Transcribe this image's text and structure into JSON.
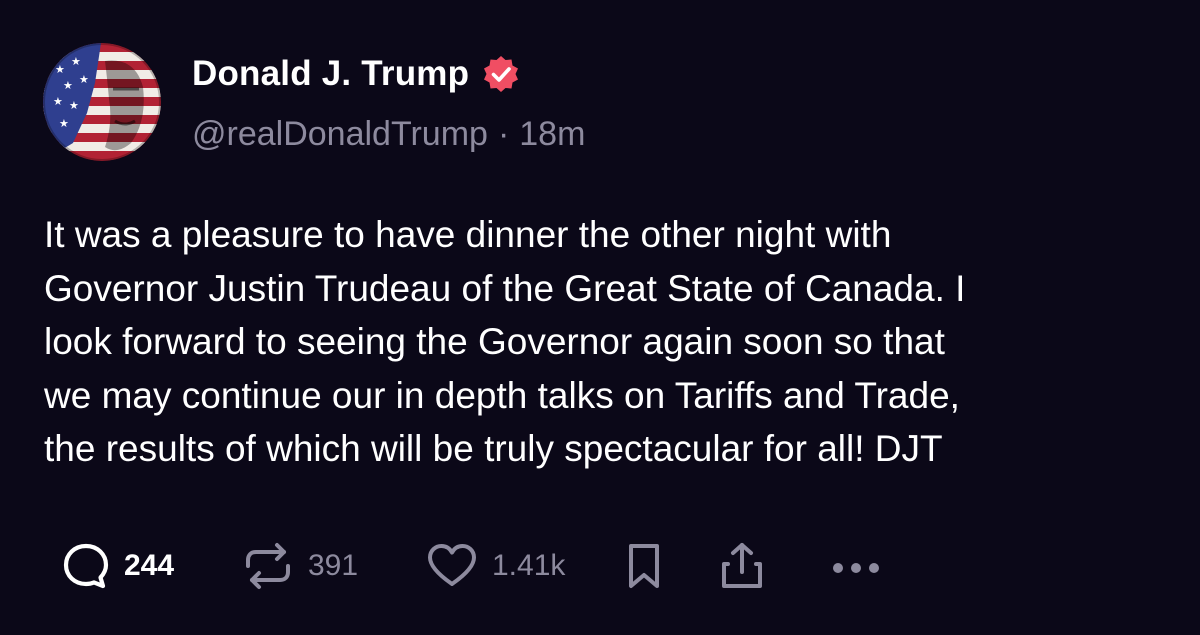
{
  "author": {
    "display_name": "Donald J. Trump",
    "handle": "@realDonaldTrump",
    "time_ago": "18m",
    "separator": "·",
    "verified": true,
    "avatar_icon": "flag-portrait-avatar",
    "verified_color": "#f04e63"
  },
  "post": {
    "text": "It was a pleasure to have dinner the other night with\nGovernor Justin Trudeau of the Great State of Canada. I\nlook forward to seeing the Governor again soon so that\nwe may continue our in depth talks on Tariffs and Trade,\nthe results of which will be truly spectacular for all! DJT"
  },
  "actions": {
    "replies": {
      "icon": "reply-bubble-icon",
      "count": "244"
    },
    "retruths": {
      "icon": "repost-icon",
      "count": "391"
    },
    "likes": {
      "icon": "heart-icon",
      "count": "1.41k"
    },
    "bookmark": {
      "icon": "bookmark-icon"
    },
    "share": {
      "icon": "share-icon"
    },
    "more": {
      "icon": "more-dots-icon"
    }
  },
  "colors": {
    "background": "#0b0818",
    "muted_text": "#8d8a9e",
    "primary_text": "#ffffff"
  }
}
